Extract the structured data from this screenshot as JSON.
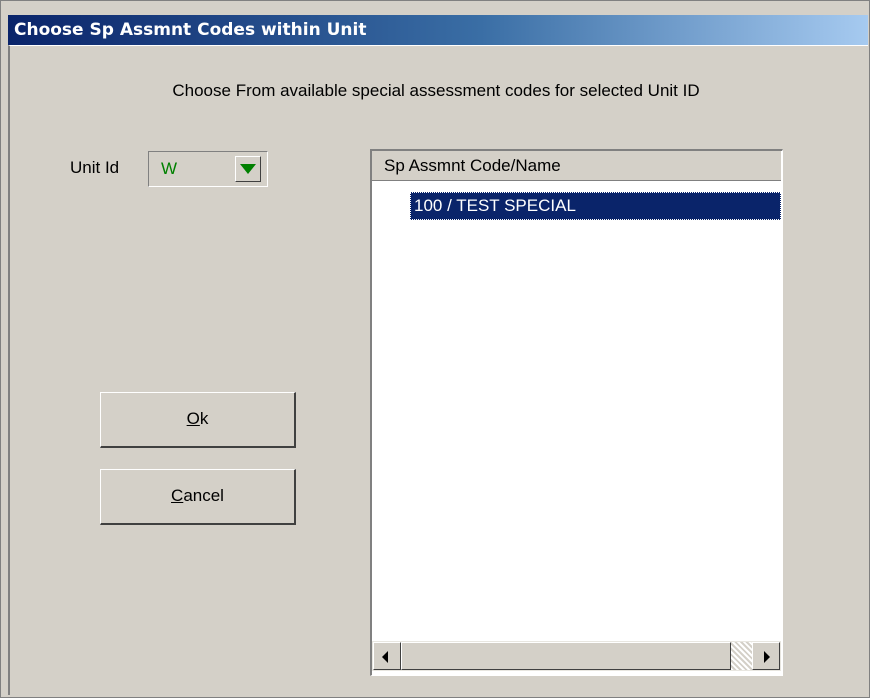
{
  "window": {
    "title": "Choose Sp Assmnt Codes within Unit"
  },
  "instruction": "Choose From available special assessment codes for selected Unit ID",
  "unit": {
    "label": "Unit Id",
    "value": "W"
  },
  "buttons": {
    "ok_label_mnemonic": "O",
    "ok_label_rest": "k",
    "cancel_label_mnemonic": "C",
    "cancel_label_rest": "ancel"
  },
  "list": {
    "header": "Sp Assmnt Code/Name",
    "items": [
      {
        "label": "100 / TEST SPECIAL",
        "selected": true
      }
    ]
  },
  "colors": {
    "title_bar_start": "#0a246a",
    "title_bar_end": "#a6caf0",
    "selection": "#0a246a",
    "unit_value": "#008000",
    "face": "#d4d0c8"
  }
}
